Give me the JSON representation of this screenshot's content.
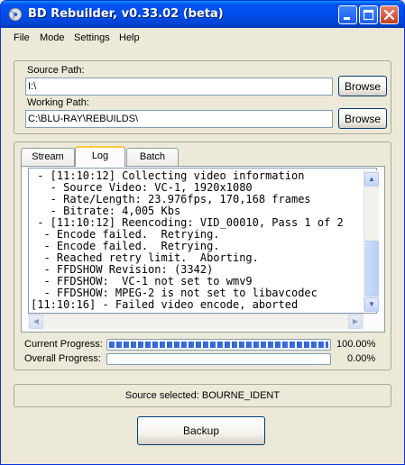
{
  "window": {
    "title": "BD Rebuilder, v0.33.02 (beta)",
    "icon": "bd-rebuilder-app-icon",
    "controls": [
      "minimize-icon",
      "maximize-icon",
      "close-icon"
    ]
  },
  "menu": [
    "File",
    "Mode",
    "Settings",
    "Help"
  ],
  "paths": {
    "source_label": "Source Path:",
    "source_value": "I:\\",
    "working_label": "Working Path:",
    "working_value": "C:\\BLU-RAY\\REBUILDS\\",
    "browse_label": "Browse"
  },
  "tabs": [
    {
      "label": "Stream",
      "active": false
    },
    {
      "label": "Log",
      "active": true
    },
    {
      "label": "Batch",
      "active": false
    }
  ],
  "log_lines": [
    " - [11:10:12] Collecting video information",
    "   - Source Video: VC-1, 1920x1080",
    "   - Rate/Length: 23.976fps, 170,168 frames",
    "   - Bitrate: 4,005 Kbs",
    " - [11:10:12] Reencoding: VID_00010, Pass 1 of 2",
    "  - Encode failed.  Retrying.",
    "  - Encode failed.  Retrying.",
    "  - Reached retry limit.  Aborting.",
    "  - FFDSHOW Revision: (3342)",
    "  - FFDSHOW:  VC-1 not set to wmv9",
    "  - FFDSHOW: MPEG-2 is not set to libavcodec",
    "[11:10:16] - Failed video encode, aborted"
  ],
  "progress": {
    "current_label": "Current Progress:",
    "current_value": 1.0,
    "current_text": "100.00%",
    "overall_label": "Overall Progress:",
    "overall_value": 0.0,
    "overall_text": "0.00%"
  },
  "status": {
    "text": "Source selected: BOURNE_IDENT"
  },
  "actions": {
    "backup_label": "Backup"
  },
  "colors": {
    "titlebar": "#0053ee",
    "progress_fill": "#3c6fe6",
    "window_bg": "#ece9d8"
  }
}
